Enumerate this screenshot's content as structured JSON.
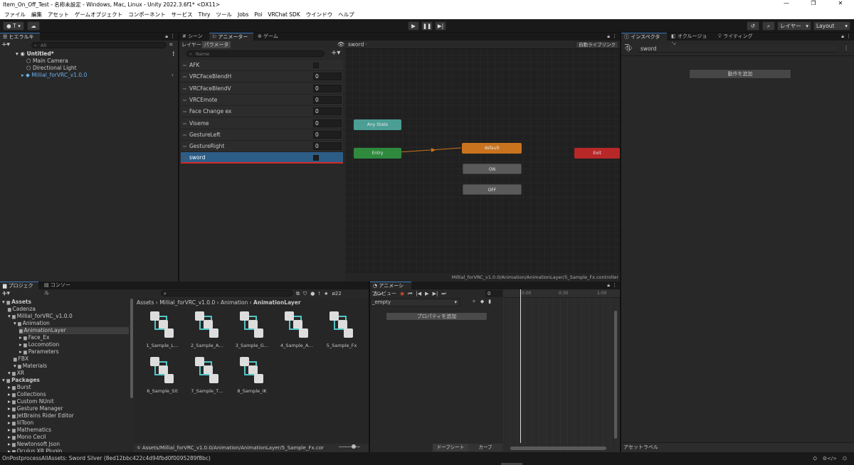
{
  "window": {
    "title": "Item_On_Off_Test - 名称未設定 - Windows, Mac, Linux - Unity 2022.3.6f1* <DX11>"
  },
  "menu": [
    "ファイル",
    "編集",
    "アセット",
    "ゲームオブジェクト",
    "コンポーネント",
    "サービス",
    "Thry",
    "ツール",
    "Jobs",
    "Poi",
    "VRChat SDK",
    "ウインドウ",
    "ヘルプ"
  ],
  "toolbar": {
    "account_label": "T",
    "layers_label": "レイヤー",
    "layout_label": "Layout"
  },
  "hierarchy": {
    "tab": "ヒエラルキー",
    "search_placeholder": "All",
    "scene": "Untitled*",
    "items": [
      "Main Camera",
      "Directional Light",
      "Millial_forVRC_v1.0.0"
    ]
  },
  "center_tabs": [
    "シーン",
    "アニメーター",
    "ゲーム"
  ],
  "animator": {
    "subtabs": [
      "レイヤー",
      "パラメーター"
    ],
    "search_placeholder": "Name",
    "params": [
      {
        "name": "AFK",
        "type": "bool",
        "value": ""
      },
      {
        "name": "VRCFaceBlendH",
        "type": "float",
        "value": "0"
      },
      {
        "name": "VRCFaceBlendV",
        "type": "float",
        "value": "0"
      },
      {
        "name": "VRCEmote",
        "type": "int",
        "value": "0"
      },
      {
        "name": "Face Change ex",
        "type": "int",
        "value": "0"
      },
      {
        "name": "Viseme",
        "type": "int",
        "value": "0"
      },
      {
        "name": "GestureLeft",
        "type": "int",
        "value": "0"
      },
      {
        "name": "GestureRight",
        "type": "int",
        "value": "0"
      },
      {
        "name": "sword",
        "type": "bool",
        "value": "",
        "selected": true
      }
    ],
    "breadcrumb": "sword",
    "auto_live_link": "自動ライブリンク",
    "nodes": {
      "any": "Any State",
      "entry": "Entry",
      "default": "default",
      "on": "ON",
      "off": "OFF",
      "exit": "Exit"
    },
    "footer_path": "Millial_forVRC_v1.0.0/Animation/AnimationLayer/5_Sample_Fx.controller"
  },
  "inspector": {
    "tabs": [
      "インスペクター",
      "オクルージョン",
      "ライティング"
    ],
    "object_name": "sword",
    "add_behaviour": "動作を追加",
    "asset_label": "アセットラベル"
  },
  "project": {
    "tabs": [
      "プロジェクト",
      "コンソール"
    ],
    "hidden_count": "22",
    "tree": [
      {
        "label": "Assets",
        "level": 0,
        "bold": true
      },
      {
        "label": "Cadenza",
        "level": 1
      },
      {
        "label": "Millial_forVRC_v1.0.0",
        "level": 1
      },
      {
        "label": "Animation",
        "level": 2
      },
      {
        "label": "AnimationLayer",
        "level": 3,
        "selected": true
      },
      {
        "label": "Face_Ex",
        "level": 3
      },
      {
        "label": "Locomotion",
        "level": 3
      },
      {
        "label": "Parameters",
        "level": 3
      },
      {
        "label": "FBX",
        "level": 2
      },
      {
        "label": "Materials",
        "level": 2
      },
      {
        "label": "XR",
        "level": 1
      },
      {
        "label": "Packages",
        "level": 0,
        "bold": true
      },
      {
        "label": "Burst",
        "level": 1
      },
      {
        "label": "Collections",
        "level": 1
      },
      {
        "label": "Custom NUnit",
        "level": 1
      },
      {
        "label": "Gesture Manager",
        "level": 1
      },
      {
        "label": "JetBrains Rider Editor",
        "level": 1
      },
      {
        "label": "lilToon",
        "level": 1
      },
      {
        "label": "Mathematics",
        "level": 1
      },
      {
        "label": "Mono Cecil",
        "level": 1
      },
      {
        "label": "Newtonsoft Json",
        "level": 1
      },
      {
        "label": "Oculus XR Plugin",
        "level": 1
      }
    ],
    "breadcrumb": [
      "Assets",
      "Millial_forVRC_v1.0.0",
      "Animation",
      "AnimationLayer"
    ],
    "assets": [
      "1_Sample_L…",
      "2_Sample_A…",
      "3_Sample_G…",
      "4_Sample_A…",
      "5_Sample_Fx",
      "6_Sample_Sit",
      "7_Sample_T…",
      "8_Sample_IK"
    ],
    "footer_path": "Assets/Millial_forVRC_v1.0.0/Animation/AnimationLayer/5_Sample_Fx.cor"
  },
  "animation": {
    "tab": "アニメーション",
    "preview": "プレビュー",
    "frame": "0",
    "clip": "_empty",
    "add_property": "プロパティを追加",
    "times": [
      "0:00",
      "0:30",
      "1:00"
    ],
    "dopesheet": "ドープシート",
    "curves": "カーブ"
  },
  "status": {
    "message": "OnPostprocessAllAssets: Sword Silver (8ed12bbc422c4d94fbd0f0095289f8bc)"
  },
  "colors": {
    "accent": "#3a79bb",
    "selected_row": "#2c5d87",
    "underline": "#d42a2a",
    "anystate": "#4b9e94",
    "entry": "#2f8a3e",
    "default": "#c9731f",
    "exit": "#b82828"
  }
}
